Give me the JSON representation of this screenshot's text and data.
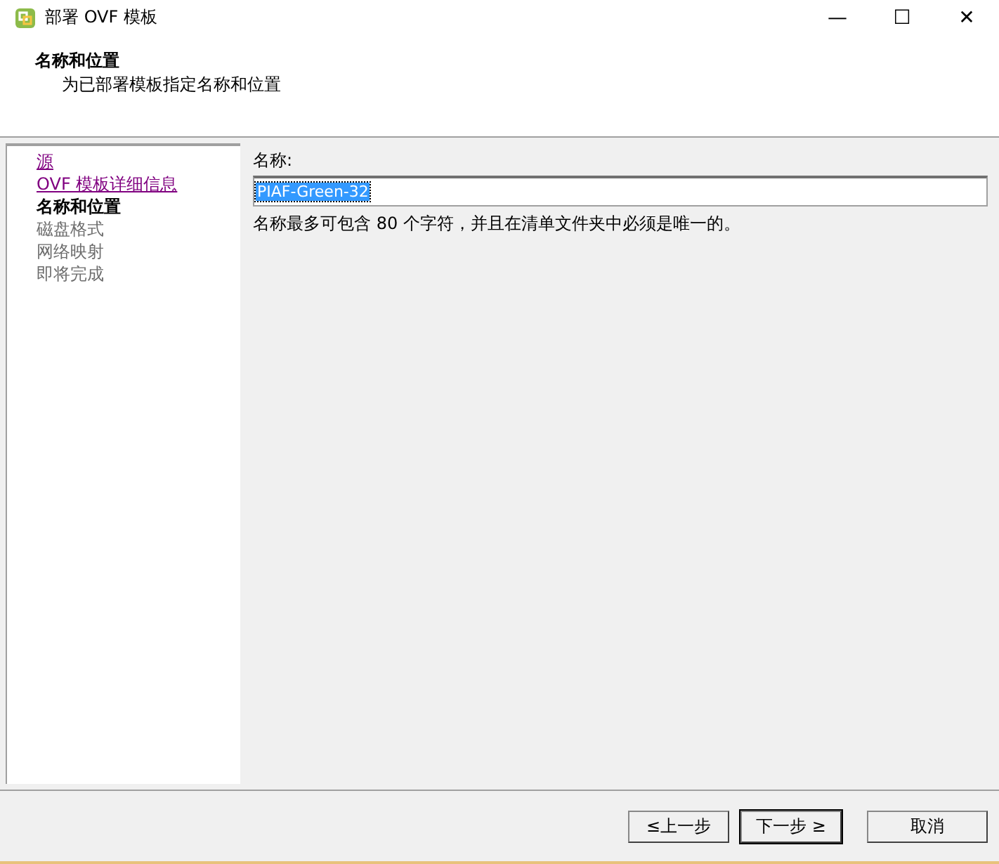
{
  "window": {
    "title": "部署 OVF 模板",
    "controls": [
      "—",
      "☐",
      "✕"
    ]
  },
  "header": {
    "title": "名称和位置",
    "subtitle": "为已部署模板指定名称和位置"
  },
  "steps": [
    {
      "label": "源",
      "kind": "visited"
    },
    {
      "label": "OVF 模板详细信息",
      "kind": "visited"
    },
    {
      "label": "名称和位置",
      "kind": "current"
    },
    {
      "label": "磁盘格式",
      "kind": "pending"
    },
    {
      "label": "网络映射",
      "kind": "pending"
    },
    {
      "label": "即将完成",
      "kind": "pending"
    }
  ],
  "form": {
    "label": "名称:",
    "value": "PIAF-Green-32",
    "selected": true,
    "hint": "名称最多可包含 80 个字符，并且在清单文件夹中必须是唯一的。"
  },
  "buttons": [
    {
      "label": "≤上一步",
      "default": false
    },
    {
      "label": "下一步 ≥",
      "default": true
    },
    {
      "label": "取消",
      "default": false
    }
  ]
}
